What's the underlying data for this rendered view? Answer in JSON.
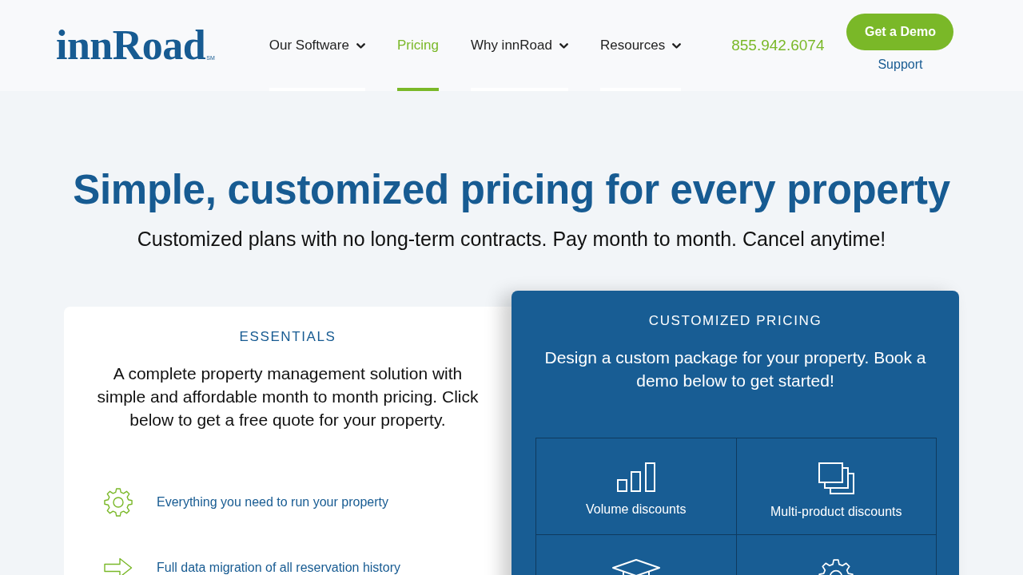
{
  "header": {
    "logo": {
      "wordmark": "innRoad",
      "mark": "SM"
    },
    "nav": [
      {
        "label": "Our Software",
        "has_menu": true,
        "selected": false
      },
      {
        "label": "Pricing",
        "has_menu": false,
        "selected": true
      },
      {
        "label": "Why innRoad",
        "has_menu": true,
        "selected": false
      },
      {
        "label": "Resources",
        "has_menu": true,
        "selected": false
      }
    ],
    "phone": "855.942.6074",
    "demo_button": "Get a Demo",
    "support_link": "Support"
  },
  "hero": {
    "title": "Simple, customized pricing for every property",
    "subtitle": "Customized plans with no long-term contracts. Pay month to month. Cancel anytime!"
  },
  "essentials": {
    "title": "ESSENTIALS",
    "description": "A complete property management solution with simple and affordable month to month pricing. Click below to get a free quote for your property.",
    "features": [
      {
        "kind": "gear",
        "text": "Everything you need to run your property"
      },
      {
        "kind": "arrow",
        "text": "Full data migration of all reservation history"
      }
    ]
  },
  "customized": {
    "title": "CUSTOMIZED PRICING",
    "description": "Design a custom package for your property. Book a demo below to get started!",
    "benefits": [
      {
        "kind": "bars",
        "label": "Volume discounts"
      },
      {
        "kind": "stack",
        "label": "Multi-product discounts"
      },
      {
        "kind": "cap"
      },
      {
        "kind": "gear"
      }
    ]
  }
}
